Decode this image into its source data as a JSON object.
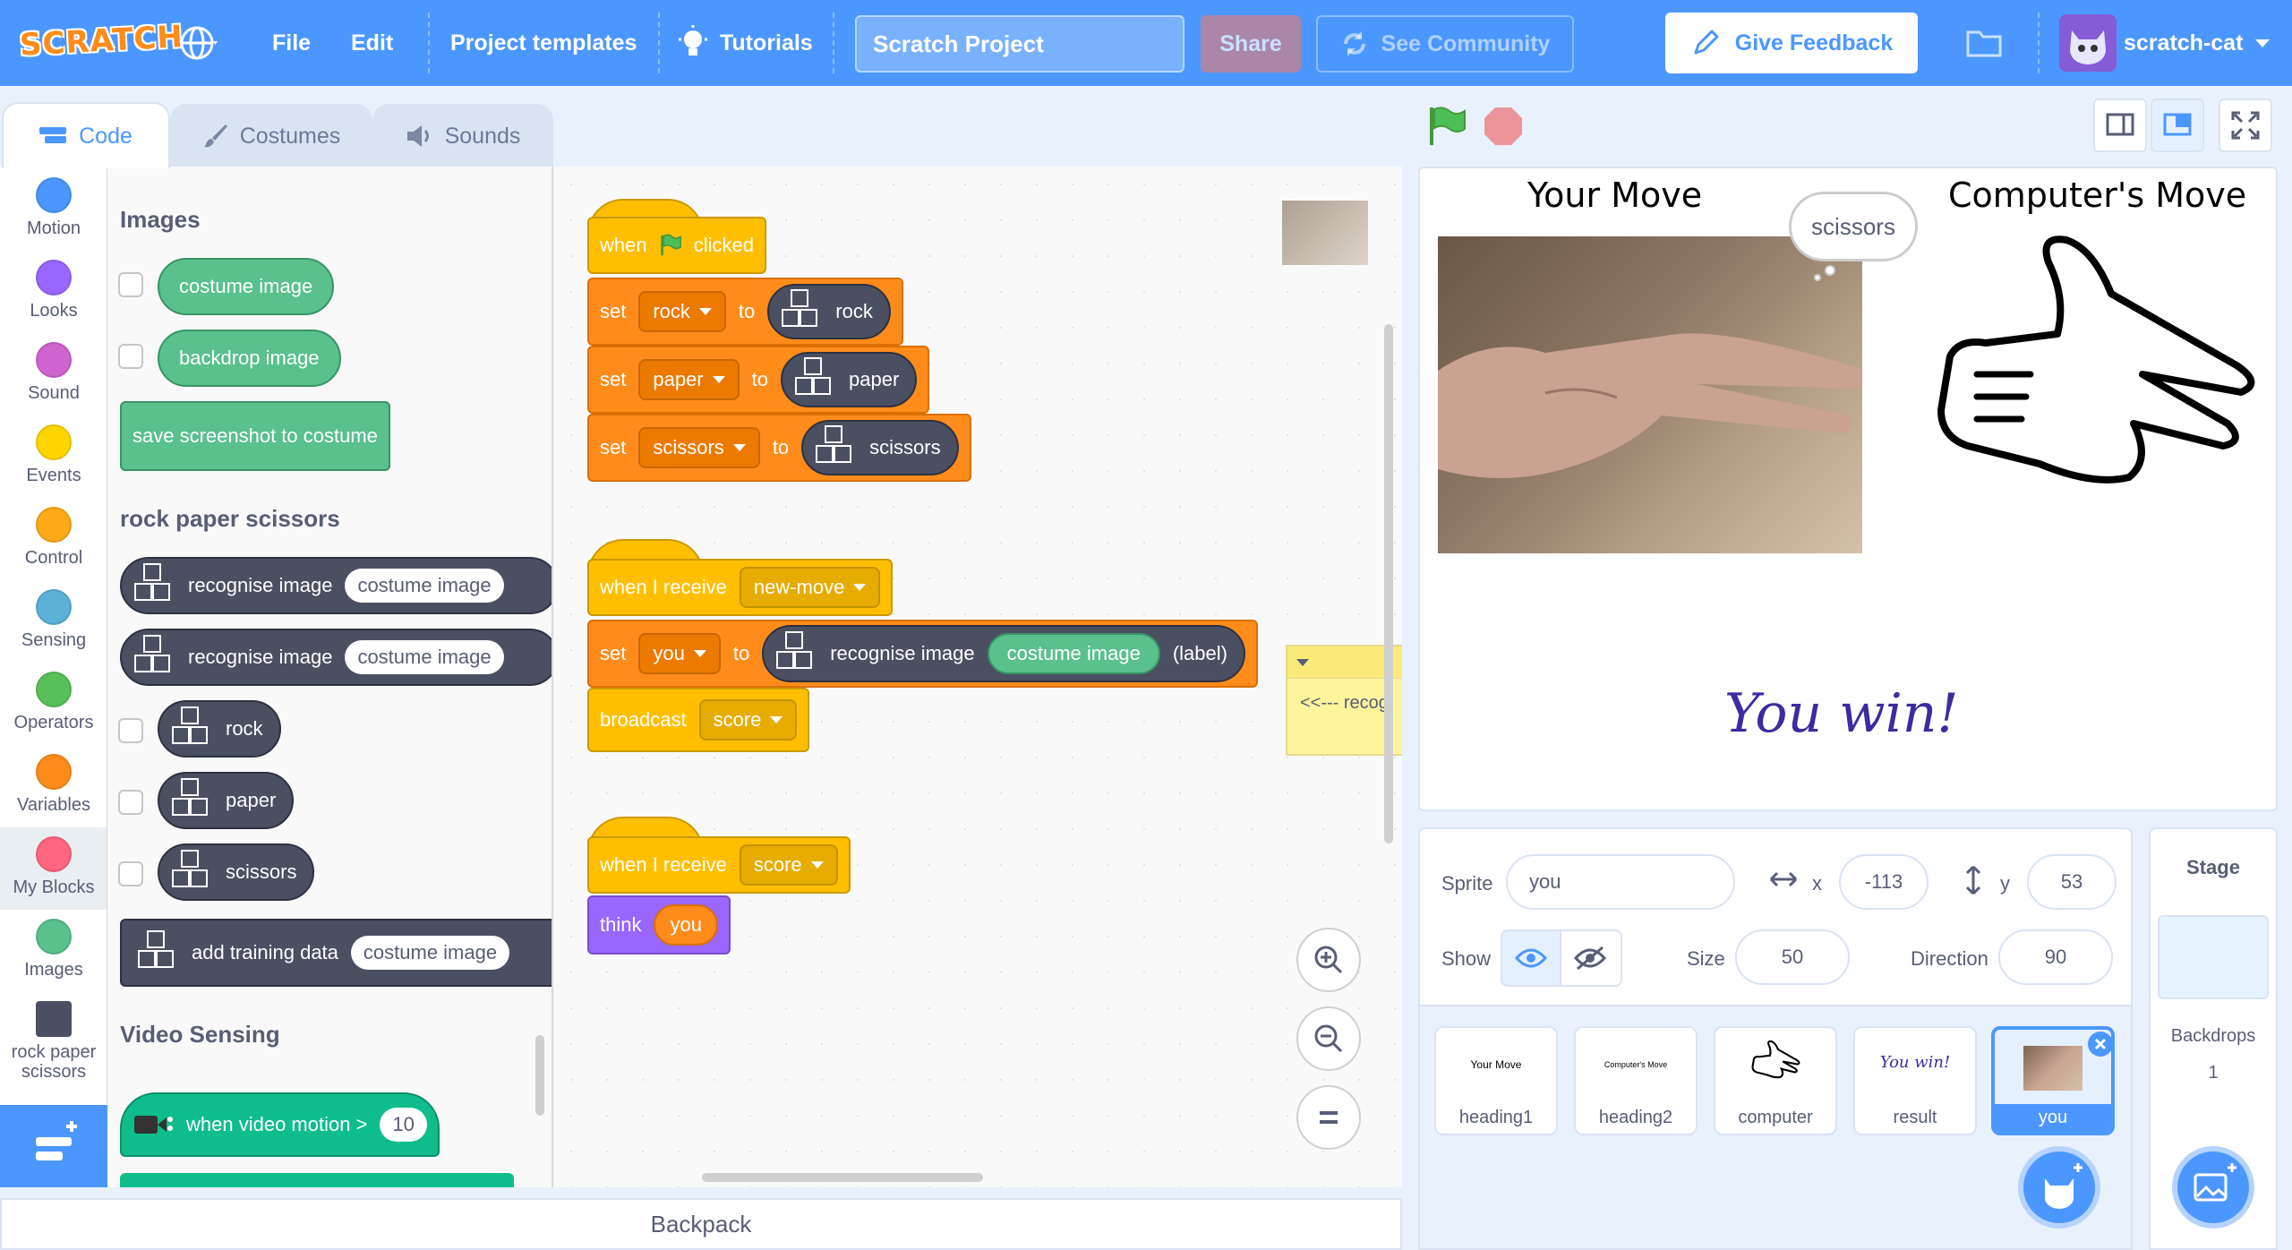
{
  "menu": {
    "logo": "SCRATCH",
    "file": "File",
    "edit": "Edit",
    "templates": "Project templates",
    "tutorials": "Tutorials",
    "project_title": "Scratch Project",
    "share": "Share",
    "see_community": "See Community",
    "give_feedback": "Give Feedback",
    "username": "scratch-cat"
  },
  "tabs": {
    "code": "Code",
    "costumes": "Costumes",
    "sounds": "Sounds"
  },
  "categories": [
    {
      "label": "Motion",
      "color": "#4c97ff"
    },
    {
      "label": "Looks",
      "color": "#9966ff"
    },
    {
      "label": "Sound",
      "color": "#cf63cf"
    },
    {
      "label": "Events",
      "color": "#ffd500"
    },
    {
      "label": "Control",
      "color": "#ffab19"
    },
    {
      "label": "Sensing",
      "color": "#5cb1d6"
    },
    {
      "label": "Operators",
      "color": "#59c059"
    },
    {
      "label": "Variables",
      "color": "#ff8c1a"
    },
    {
      "label": "My Blocks",
      "color": "#ff6680"
    },
    {
      "label": "Images",
      "color": "#59c08e"
    },
    {
      "label": "rock paper scissors",
      "color": "#4a4f62"
    }
  ],
  "palette": {
    "images_heading": "Images",
    "costume_image": "costume image",
    "backdrop_image": "backdrop image",
    "save_screenshot": "save screenshot to costume",
    "rps_heading": "rock paper scissors",
    "recognise_image": "recognise image",
    "rock": "rock",
    "paper": "paper",
    "scissors": "scissors",
    "add_training": "add training data",
    "video_heading": "Video Sensing",
    "video_motion": "when video motion >",
    "video_motion_value": "10"
  },
  "scripts": {
    "when": "when",
    "clicked": "clicked",
    "set": "set",
    "to": "to",
    "rock": "rock",
    "paper": "paper",
    "scissors": "scissors",
    "when_receive": "when I receive",
    "new_move": "new-move",
    "you": "you",
    "recognise_image": "recognise image",
    "costume_image": "costume image",
    "label": "(label)",
    "broadcast": "broadcast",
    "score": "score",
    "think": "think",
    "comment": "<<--- recog"
  },
  "stage": {
    "your_move": "Your Move",
    "computers_move": "Computer's Move",
    "bubble": "scissors",
    "result": "You win!"
  },
  "sprite_info": {
    "sprite_label": "Sprite",
    "sprite_name": "you",
    "x_label": "x",
    "x": "-113",
    "y_label": "y",
    "y": "53",
    "show_label": "Show",
    "size_label": "Size",
    "size": "50",
    "direction_label": "Direction",
    "direction": "90"
  },
  "sprites": [
    {
      "name": "heading1",
      "thumb": "Your Move"
    },
    {
      "name": "heading2",
      "thumb": "Computer's Move"
    },
    {
      "name": "computer",
      "thumb": ""
    },
    {
      "name": "result",
      "thumb": "You win!"
    },
    {
      "name": "you",
      "thumb": ""
    }
  ],
  "stage_panel": {
    "title": "Stage",
    "backdrops_label": "Backdrops",
    "backdrops_count": "1"
  },
  "backpack": "Backpack"
}
